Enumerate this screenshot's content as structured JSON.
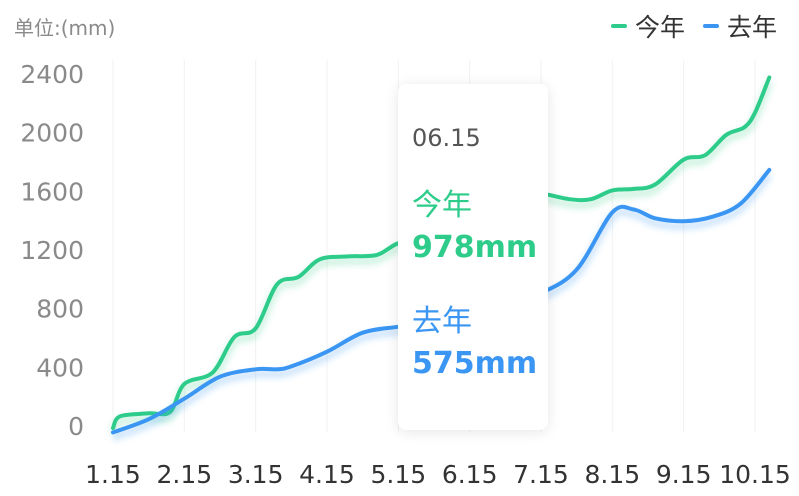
{
  "unit_label": "单位:(mm)",
  "legend": [
    {
      "name": "今年",
      "color": "#2ecc8a"
    },
    {
      "name": "去年",
      "color": "#3a96f2"
    }
  ],
  "tooltip": {
    "date": "06.15",
    "current_label": "今年",
    "current_value": "978mm",
    "last_label": "去年",
    "last_value": "575mm"
  },
  "chart_data": {
    "type": "line",
    "x": [
      "1.15",
      "2.15",
      "3.15",
      "4.15",
      "5.15",
      "6.15",
      "7.15",
      "8.15",
      "9.15",
      "10.15"
    ],
    "yticks": [
      "0",
      "400",
      "800",
      "1200",
      "1600",
      "2000",
      "2400"
    ],
    "ylim": [
      0,
      2400
    ],
    "grid": "vertical",
    "legend_position": "top-right",
    "series": [
      {
        "name": "今年",
        "color": "#2ecc8a",
        "points": [
          [
            1.0,
            0
          ],
          [
            1.1,
            80
          ],
          [
            1.5,
            100
          ],
          [
            1.8,
            110
          ],
          [
            2.0,
            300
          ],
          [
            2.4,
            380
          ],
          [
            2.7,
            620
          ],
          [
            3.0,
            680
          ],
          [
            3.3,
            980
          ],
          [
            3.6,
            1030
          ],
          [
            3.9,
            1150
          ],
          [
            4.3,
            1170
          ],
          [
            4.7,
            1180
          ],
          [
            5.0,
            1260
          ],
          [
            5.4,
            1300
          ],
          [
            6.0,
            1440
          ],
          [
            6.6,
            1620
          ],
          [
            7.0,
            1600
          ],
          [
            7.4,
            1560
          ],
          [
            7.7,
            1560
          ],
          [
            8.0,
            1620
          ],
          [
            8.3,
            1630
          ],
          [
            8.6,
            1660
          ],
          [
            9.0,
            1830
          ],
          [
            9.3,
            1860
          ],
          [
            9.6,
            2000
          ],
          [
            9.85,
            2050
          ],
          [
            10.0,
            2150
          ],
          [
            10.2,
            2390
          ]
        ]
      },
      {
        "name": "去年",
        "color": "#3a96f2",
        "points": [
          [
            1.0,
            -30
          ],
          [
            1.5,
            60
          ],
          [
            2.0,
            200
          ],
          [
            2.5,
            350
          ],
          [
            3.0,
            400
          ],
          [
            3.3,
            400
          ],
          [
            3.5,
            420
          ],
          [
            4.0,
            520
          ],
          [
            4.5,
            650
          ],
          [
            5.0,
            690
          ],
          [
            5.5,
            720
          ],
          [
            6.0,
            780
          ],
          [
            6.5,
            850
          ],
          [
            7.0,
            920
          ],
          [
            7.5,
            1080
          ],
          [
            8.0,
            1470
          ],
          [
            8.3,
            1490
          ],
          [
            8.6,
            1430
          ],
          [
            9.0,
            1410
          ],
          [
            9.4,
            1440
          ],
          [
            9.8,
            1530
          ],
          [
            10.2,
            1760
          ]
        ]
      }
    ]
  }
}
